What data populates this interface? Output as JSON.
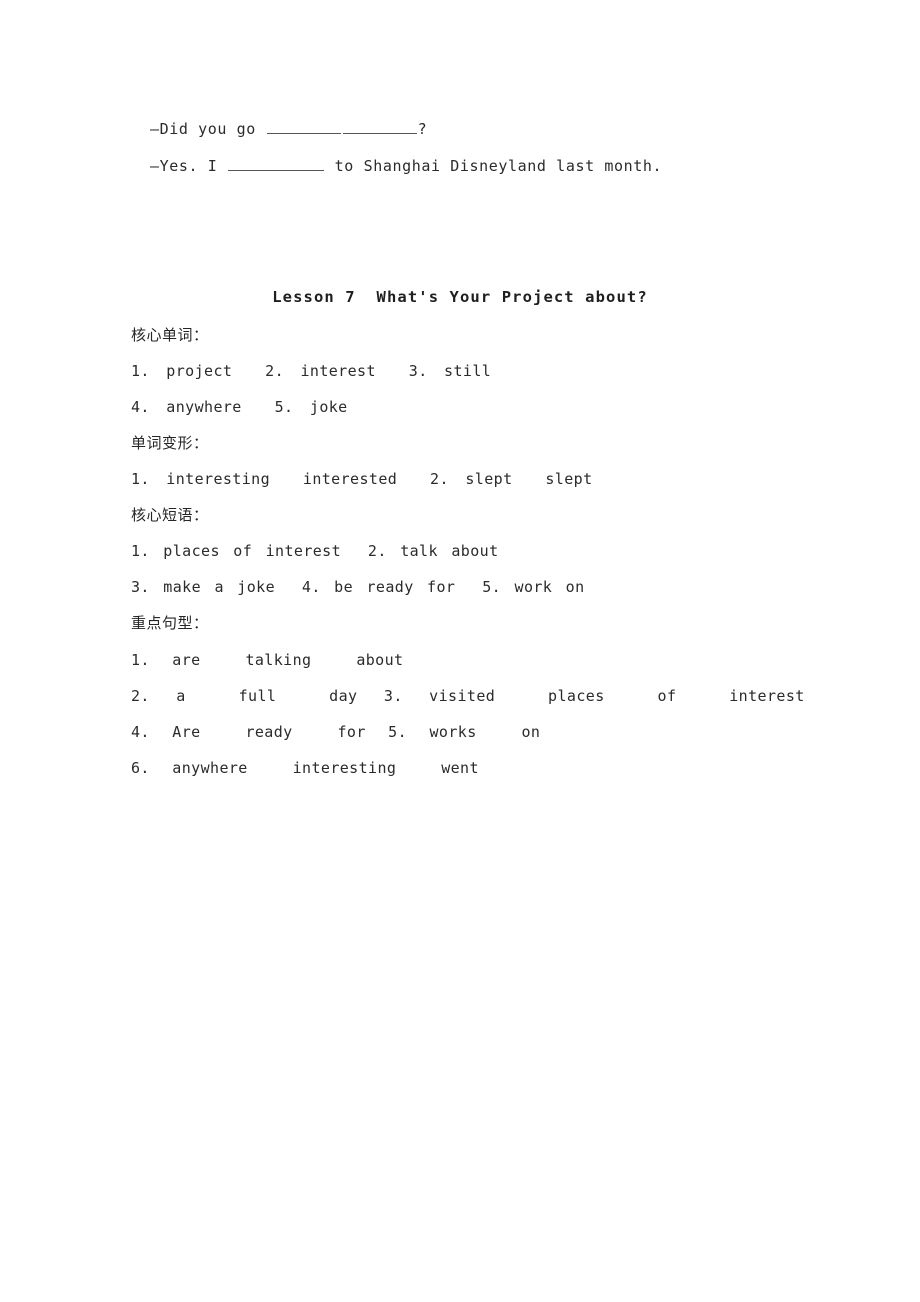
{
  "document": {
    "background_color": "#ffffff",
    "text_color": "#2b2b2b"
  },
  "dialogue": {
    "line1_prefix": "—Did you go ",
    "line1_suffix": "?",
    "line2_prefix": "—Yes. I ",
    "line2_suffix": " to Shanghai Disneyland last month."
  },
  "lesson": {
    "title": "Lesson 7  What's Your Project about?"
  },
  "sections": [
    {
      "heading": "核心单词：",
      "lines": [
        "1. project  2. interest  3. still",
        "4. anywhere  5. joke"
      ]
    },
    {
      "heading": "单词变形：",
      "lines": [
        "1. interesting  interested  2. slept  slept"
      ]
    },
    {
      "heading": "核心短语：",
      "lines": [
        "1. places of interest  2. talk about",
        "3. make a joke  4. be ready for  5. work on"
      ]
    },
    {
      "heading": "重点句型：",
      "lines": [
        "1. are  talking  about",
        "2. a  full  day 3. visited  places  of  interest",
        "4. Are  ready  for 5. works  on",
        "6. anywhere  interesting  went"
      ]
    }
  ]
}
